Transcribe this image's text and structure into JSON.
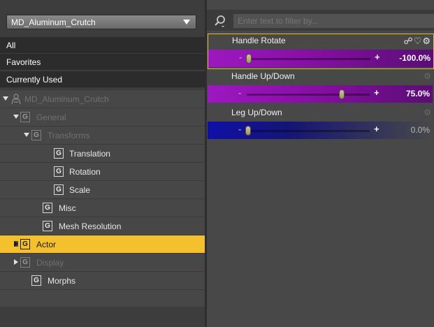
{
  "node_selector": {
    "value": "MD_Aluminum_Crutch"
  },
  "quick_filters": [
    "All",
    "Favorites",
    "Currently Used"
  ],
  "tree": {
    "root": "MD_Aluminum_Crutch",
    "general": "General",
    "transforms": "Transforms",
    "translation": "Translation",
    "rotation": "Rotation",
    "scale": "Scale",
    "misc": "Misc",
    "mesh_resolution": "Mesh Resolution",
    "actor": "Actor",
    "display": "Display",
    "morphs": "Morphs",
    "group_glyph": "G"
  },
  "search": {
    "placeholder": "Enter text to filter by..."
  },
  "parameters": [
    {
      "name": "Handle Rotate",
      "value": "-100.0%",
      "fraction": 0.0
    },
    {
      "name": "Handle Up/Down",
      "value": "75.0%",
      "fraction": 0.75
    },
    {
      "name": "Leg Up/Down",
      "value": "0.0%",
      "fraction": 0.0
    }
  ],
  "slider_minus": "-",
  "slider_plus": "+",
  "icons": {
    "link": "link-icon",
    "heart": "heart-icon",
    "gear": "gear-icon",
    "search": "search-icon"
  },
  "colors": {
    "selected_row": "#f5c02e",
    "purple_slider": "#8a10a8",
    "blue_slider": "#1010a0",
    "highlight_border": "#e8b830"
  }
}
